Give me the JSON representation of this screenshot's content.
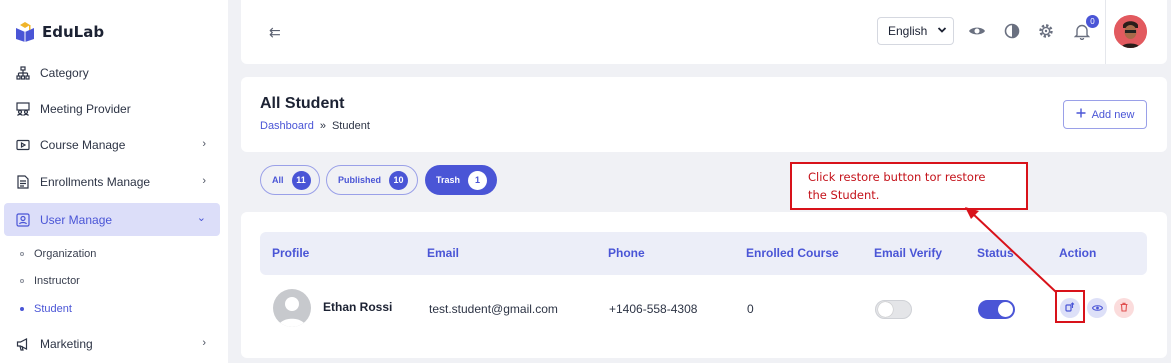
{
  "brand": {
    "name": "EduLab"
  },
  "sidebar": {
    "items": [
      {
        "label": "Category",
        "icon": "sitemap-icon",
        "has_chevron": false
      },
      {
        "label": "Meeting Provider",
        "icon": "meeting-icon",
        "has_chevron": false
      },
      {
        "label": "Course Manage",
        "icon": "video-icon",
        "has_chevron": true
      },
      {
        "label": "Enrollments Manage",
        "icon": "document-icon",
        "has_chevron": true
      },
      {
        "label": "User Manage",
        "icon": "user-box-icon",
        "has_chevron": true,
        "active": true
      },
      {
        "label": "Marketing",
        "icon": "megaphone-icon",
        "has_chevron": true
      }
    ],
    "sub_items": [
      {
        "label": "Organization"
      },
      {
        "label": "Instructor"
      },
      {
        "label": "Student",
        "active": true
      }
    ],
    "chevron_right": "›",
    "chevron_down": "⌄"
  },
  "topbar": {
    "language": "English",
    "notification_count": "0",
    "collapse_glyph": "⇇"
  },
  "header": {
    "title": "All Student",
    "breadcrumb": {
      "home": "Dashboard",
      "separator": "»",
      "current": "Student"
    },
    "add_button": "Add new"
  },
  "filters": [
    {
      "label": "All",
      "count": "11"
    },
    {
      "label": "Published",
      "count": "10"
    },
    {
      "label": "Trash",
      "count": "1",
      "active": true
    }
  ],
  "table": {
    "columns": [
      "Profile",
      "Email",
      "Phone",
      "Enrolled Course",
      "Email Verify",
      "Status",
      "Action"
    ],
    "rows": [
      {
        "name": "Ethan Rossi",
        "email": "test.student@gmail.com",
        "phone": "+1406-558-4308",
        "enrolled": "0",
        "email_verify": false,
        "status": true
      }
    ]
  },
  "annotation": {
    "line1": "Click restore button tor restore",
    "line2": "the Student."
  },
  "colors": {
    "accent": "#4a55d6",
    "callout_red": "#d8121a",
    "delete_red": "#e05050"
  }
}
